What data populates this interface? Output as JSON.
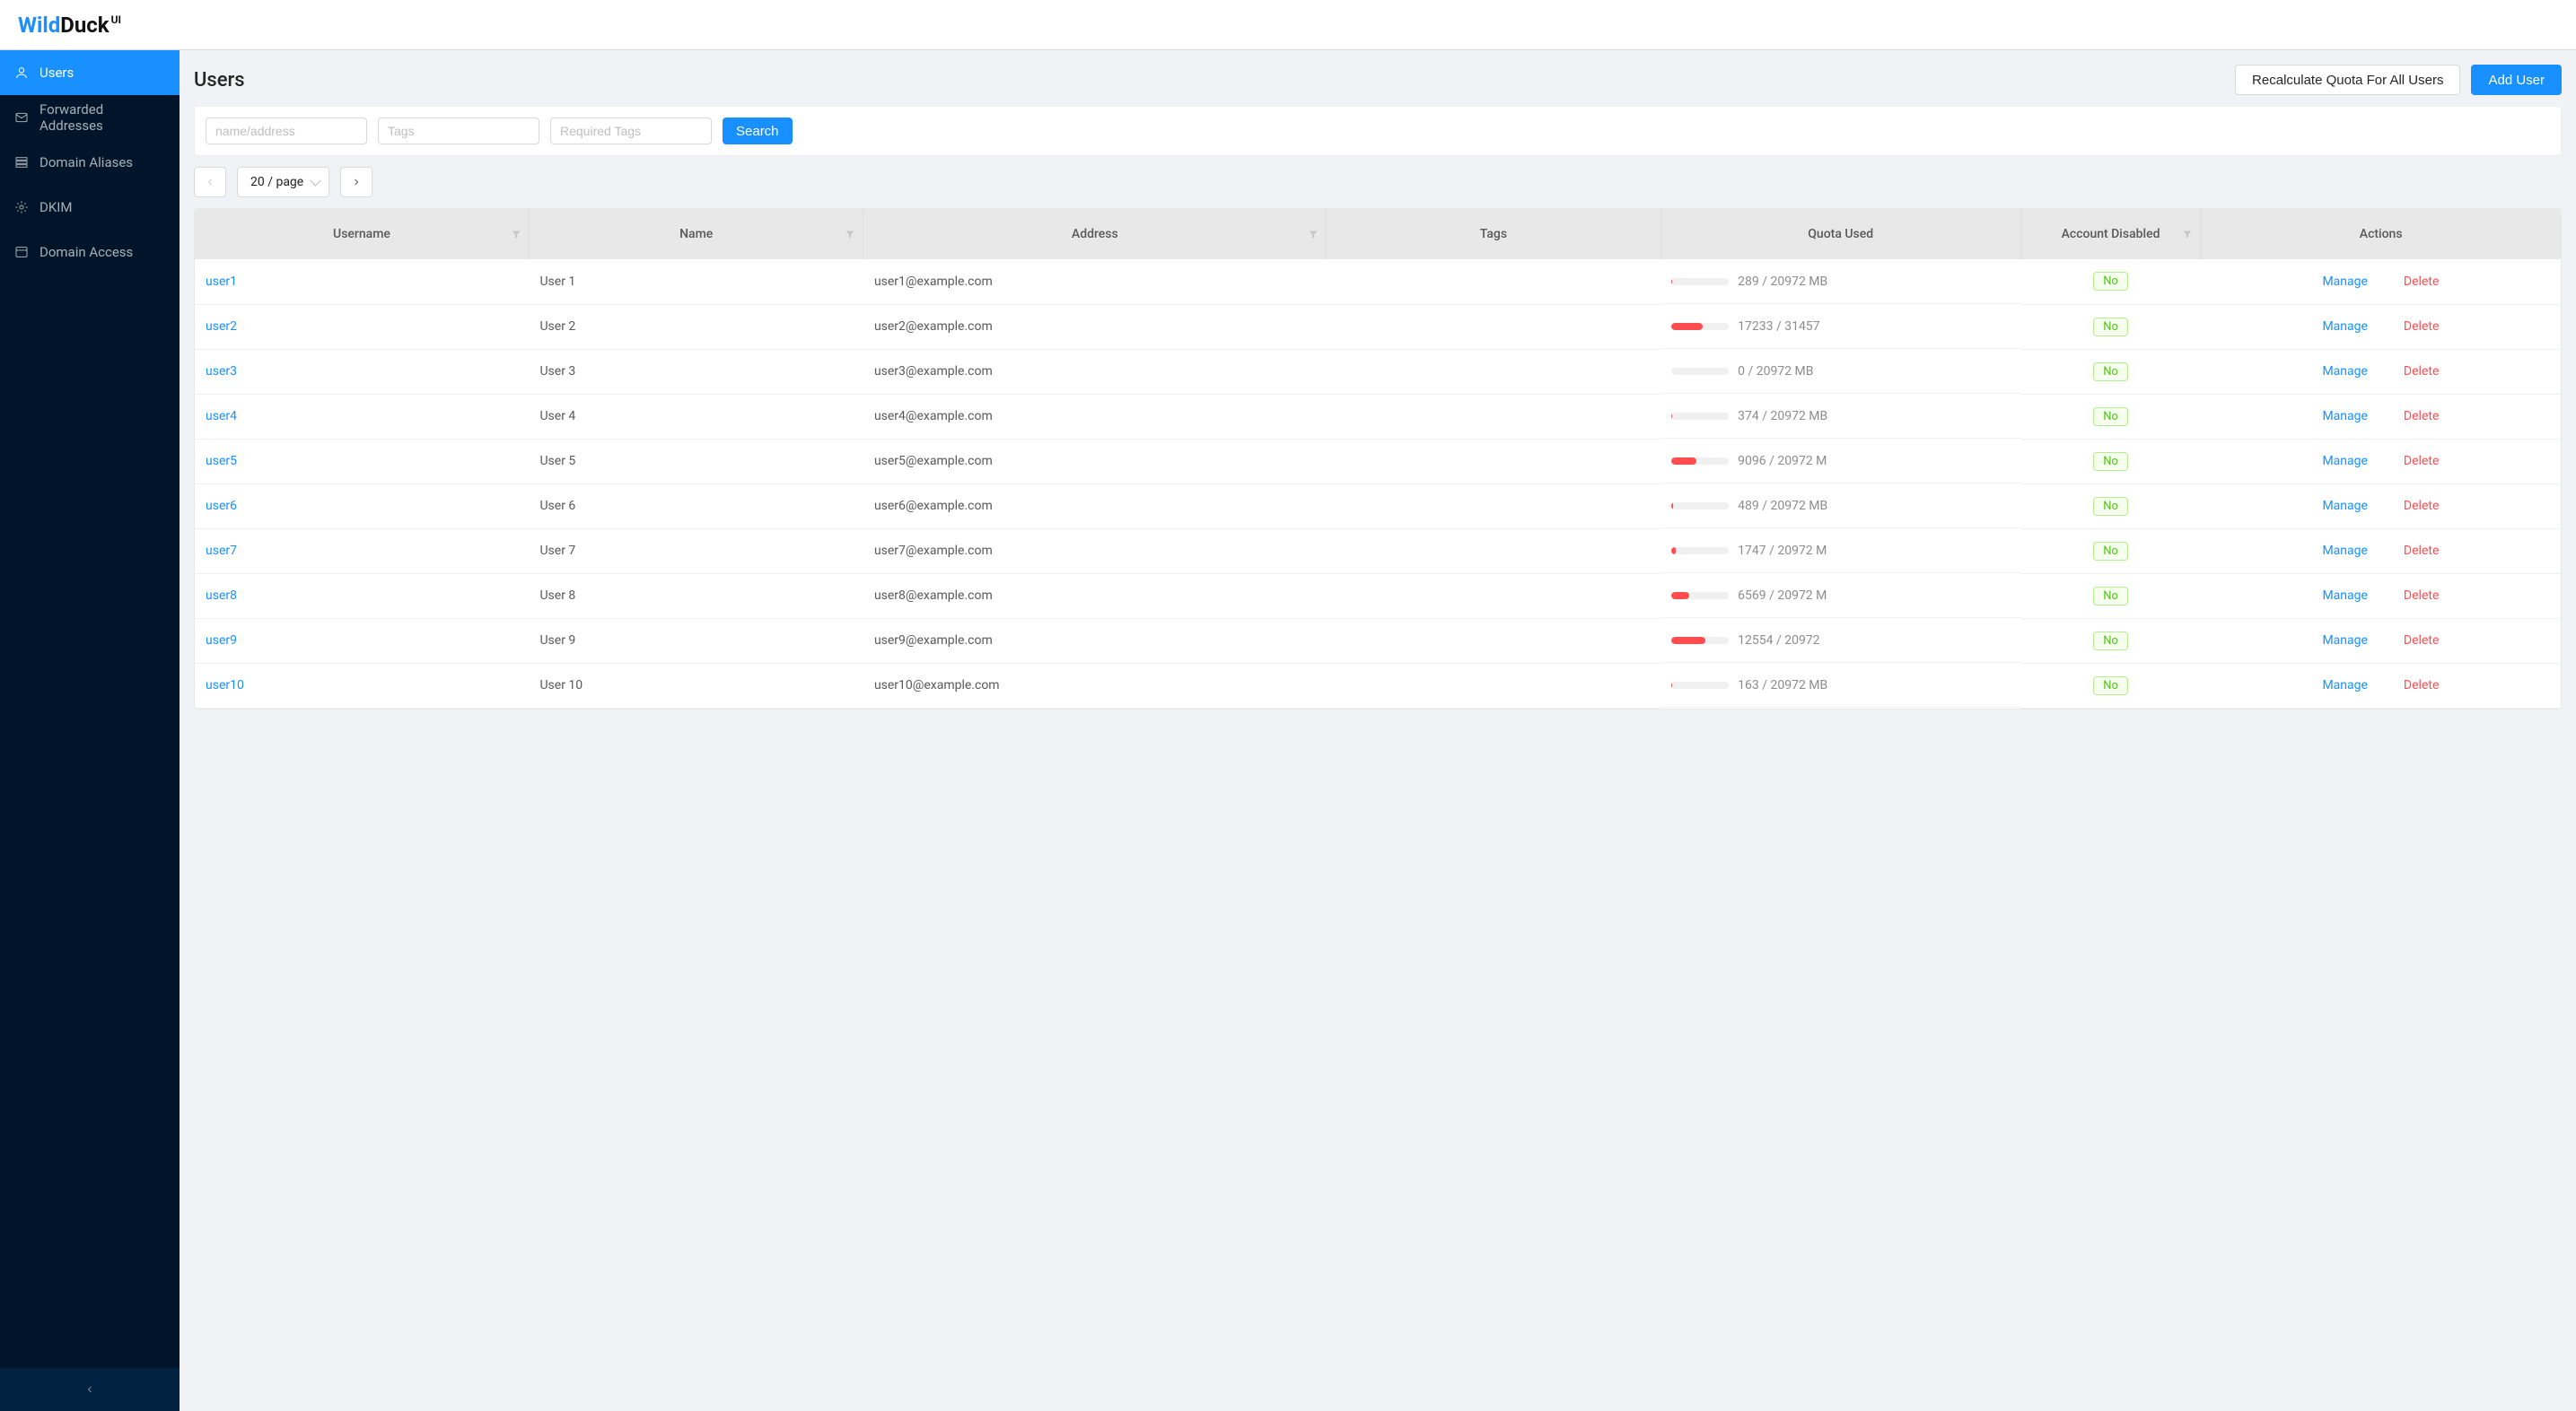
{
  "logo": {
    "wild": "Wild",
    "duck": "Duck",
    "ui": "UI"
  },
  "sidebar": {
    "items": [
      {
        "label": "Users",
        "icon": "user-icon",
        "active": true
      },
      {
        "label": "Forwarded Addresses",
        "icon": "forward-icon",
        "active": false
      },
      {
        "label": "Domain Aliases",
        "icon": "alias-icon",
        "active": false
      },
      {
        "label": "DKIM",
        "icon": "dkim-icon",
        "active": false
      },
      {
        "label": "Domain Access",
        "icon": "access-icon",
        "active": false
      }
    ]
  },
  "page": {
    "title": "Users",
    "actions": {
      "recalculate": "Recalculate Quota For All Users",
      "add_user": "Add User"
    }
  },
  "search": {
    "placeholder_name": "name/address",
    "placeholder_tags": "Tags",
    "placeholder_required": "Required Tags",
    "button": "Search"
  },
  "pagination": {
    "page_size_label": "20 / page",
    "prev_disabled": true
  },
  "table": {
    "columns": [
      {
        "label": "Username",
        "filter": true
      },
      {
        "label": "Name",
        "filter": true
      },
      {
        "label": "Address",
        "filter": true
      },
      {
        "label": "Tags",
        "filter": false
      },
      {
        "label": "Quota Used",
        "filter": false
      },
      {
        "label": "Account Disabled",
        "filter": true
      },
      {
        "label": "Actions",
        "filter": false
      }
    ],
    "disabled_badge": "No",
    "action_manage": "Manage",
    "action_delete": "Delete",
    "rows": [
      {
        "username": "user1",
        "name": "User 1",
        "address": "user1@example.com",
        "tags": "",
        "quota_used": 289,
        "quota_total": 20972,
        "quota_text": "289 / 20972 MB",
        "disabled": "No"
      },
      {
        "username": "user2",
        "name": "User 2",
        "address": "user2@example.com",
        "tags": "",
        "quota_used": 17233,
        "quota_total": 31457,
        "quota_text": "17233 / 31457",
        "disabled": "No"
      },
      {
        "username": "user3",
        "name": "User 3",
        "address": "user3@example.com",
        "tags": "",
        "quota_used": 0,
        "quota_total": 20972,
        "quota_text": "0 / 20972 MB",
        "disabled": "No"
      },
      {
        "username": "user4",
        "name": "User 4",
        "address": "user4@example.com",
        "tags": "",
        "quota_used": 374,
        "quota_total": 20972,
        "quota_text": "374 / 20972 MB",
        "disabled": "No"
      },
      {
        "username": "user5",
        "name": "User 5",
        "address": "user5@example.com",
        "tags": "",
        "quota_used": 9096,
        "quota_total": 20972,
        "quota_text": "9096 / 20972 M",
        "disabled": "No"
      },
      {
        "username": "user6",
        "name": "User 6",
        "address": "user6@example.com",
        "tags": "",
        "quota_used": 489,
        "quota_total": 20972,
        "quota_text": "489 / 20972 MB",
        "disabled": "No"
      },
      {
        "username": "user7",
        "name": "User 7",
        "address": "user7@example.com",
        "tags": "",
        "quota_used": 1747,
        "quota_total": 20972,
        "quota_text": "1747 / 20972 M",
        "disabled": "No"
      },
      {
        "username": "user8",
        "name": "User 8",
        "address": "user8@example.com",
        "tags": "",
        "quota_used": 6569,
        "quota_total": 20972,
        "quota_text": "6569 / 20972 M",
        "disabled": "No"
      },
      {
        "username": "user9",
        "name": "User 9",
        "address": "user9@example.com",
        "tags": "",
        "quota_used": 12554,
        "quota_total": 20972,
        "quota_text": "12554 / 20972",
        "disabled": "No"
      },
      {
        "username": "user10",
        "name": "User 10",
        "address": "user10@example.com",
        "tags": "",
        "quota_used": 163,
        "quota_total": 20972,
        "quota_text": "163 / 20972 MB",
        "disabled": "No"
      }
    ]
  }
}
